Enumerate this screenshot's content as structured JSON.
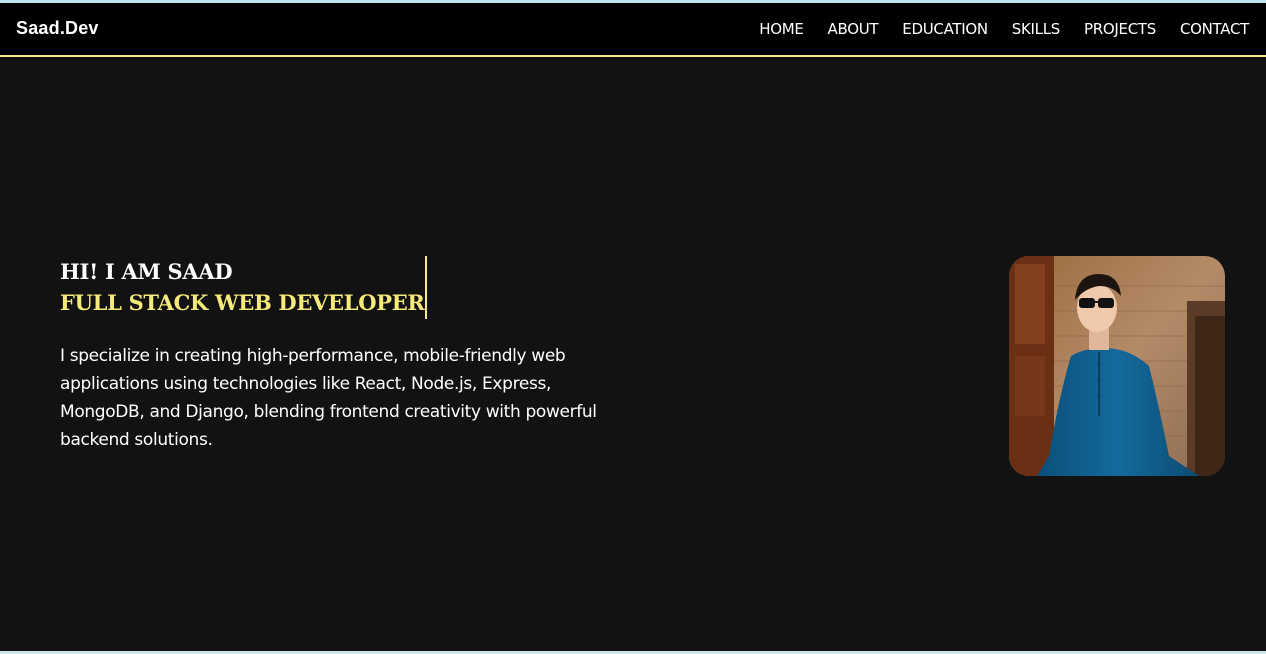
{
  "brand": {
    "logo": "Saad.Dev"
  },
  "nav": {
    "items": [
      {
        "label": "HOME"
      },
      {
        "label": "ABOUT"
      },
      {
        "label": "EDUCATION"
      },
      {
        "label": "SKILLS"
      },
      {
        "label": "PROJECTS"
      },
      {
        "label": "CONTACT"
      }
    ]
  },
  "hero": {
    "greeting": "HI! I AM SAAD",
    "role": "FULL STACK WEB DEVELOPER",
    "description": "I specialize in creating high-performance, mobile-friendly web applications using technologies like React, Node.js, Express, MongoDB, and Django, blending frontend creativity with powerful backend solutions."
  },
  "colors": {
    "background": "#121212",
    "navbar": "#000000",
    "accent": "#f6ea7a",
    "text": "#ffffff"
  }
}
